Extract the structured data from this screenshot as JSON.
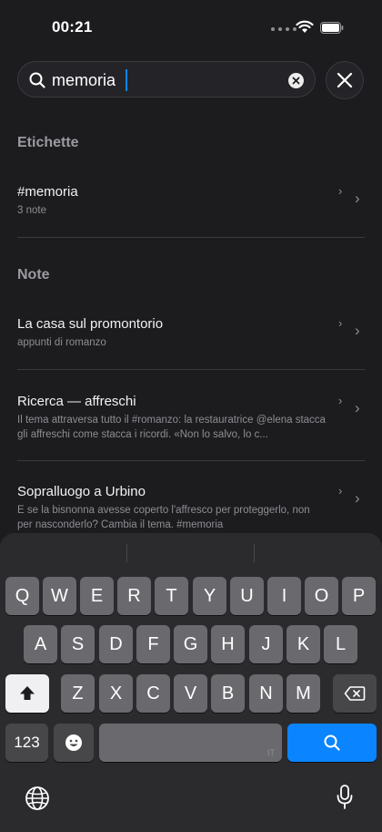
{
  "status": {
    "time": "00:21"
  },
  "search": {
    "value": "memoria",
    "placeholder": ""
  },
  "tags_section": {
    "title": "Etichette",
    "items": [
      {
        "label": "#memoria",
        "sub": "3 note"
      }
    ]
  },
  "notes_section": {
    "title": "Note",
    "items": [
      {
        "title": "La casa sul promontorio",
        "preview": "appunti di romanzo"
      },
      {
        "title": "Ricerca — affreschi",
        "preview": "Il tema attraversa tutto il #romanzo: la restauratrice @elena stacca gli affreschi come stacca i ricordi. «Non lo salvo, lo c..."
      },
      {
        "title": "Sopralluogo a Urbino",
        "preview": "E se la bisnonna avesse coperto l'affresco per proteggerlo, non per nasconderlo? Cambia il tema. #memoria"
      }
    ]
  },
  "keyboard": {
    "row1": [
      "Q",
      "W",
      "E",
      "R",
      "T",
      "Y",
      "U",
      "I",
      "O",
      "P"
    ],
    "row2": [
      "A",
      "S",
      "D",
      "F",
      "G",
      "H",
      "J",
      "K",
      "L"
    ],
    "row3": [
      "Z",
      "X",
      "C",
      "V",
      "B",
      "N",
      "M"
    ],
    "numbers_label": "123",
    "space_lang": "IT"
  },
  "icons": {
    "search": "search-icon",
    "clear": "clear-icon",
    "close": "close-icon",
    "shift": "shift-icon",
    "delete": "delete-icon",
    "emoji": "emoji-icon",
    "globe": "globe-icon",
    "mic": "microphone-icon"
  },
  "colors": {
    "accent": "#0a84ff",
    "background": "#1c1c1f",
    "keyboard": "#2b2b2e"
  }
}
